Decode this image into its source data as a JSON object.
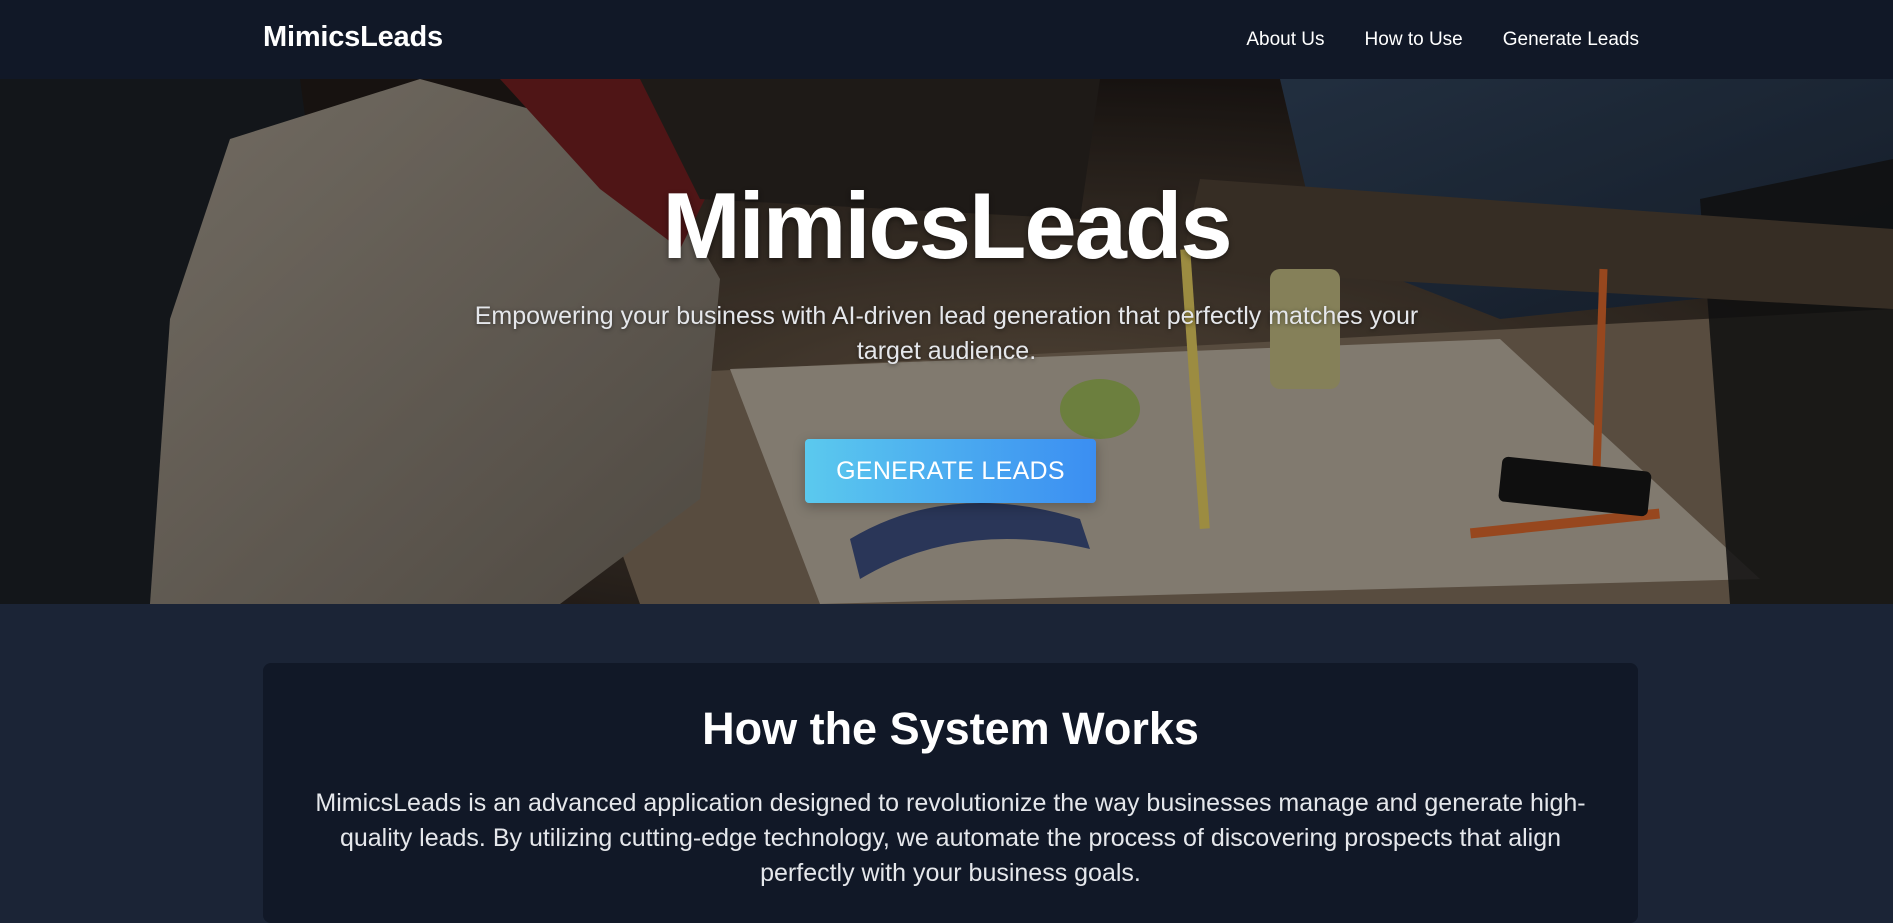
{
  "navbar": {
    "brand": "MimicsLeads",
    "links": [
      "About Us",
      "How to Use",
      "Generate Leads"
    ]
  },
  "hero": {
    "title": "MimicsLeads",
    "subtitle": "Empowering your business with AI-driven lead generation that perfectly matches your target audience.",
    "cta_label": "GENERATE LEADS"
  },
  "section": {
    "title": "How the System Works",
    "body": "MimicsLeads is an advanced application designed to revolutionize the way businesses manage and generate high-quality leads. By utilizing cutting-edge technology, we automate the process of discovering prospects that align perfectly with your business goals."
  },
  "colors": {
    "navbar_bg": "#111827",
    "page_bg": "#1b2436",
    "card_bg": "#111827",
    "cta_gradient_start": "#5bc9ee",
    "cta_gradient_end": "#3b8ef2"
  }
}
